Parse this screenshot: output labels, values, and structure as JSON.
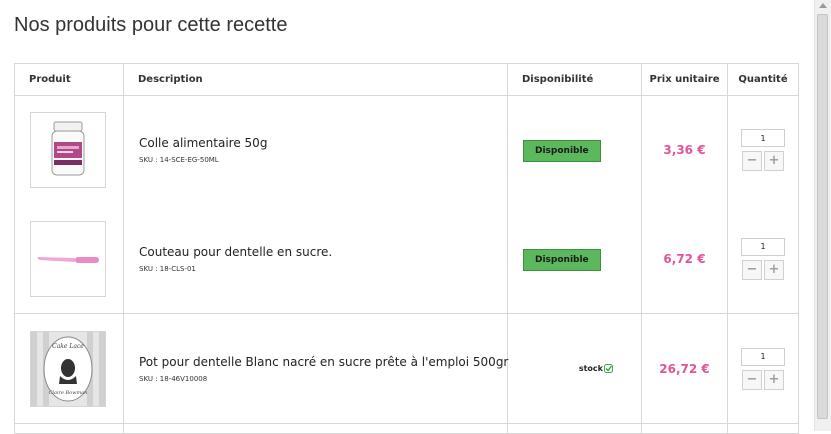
{
  "page": {
    "title": "Nos produits pour cette recette"
  },
  "table": {
    "headers": {
      "product": "Produit",
      "description": "Description",
      "availability": "Disponibilité",
      "unit_price": "Prix unitaire",
      "quantity": "Quantité"
    },
    "rows": [
      {
        "name": "Colle alimentaire 50g",
        "sku": "SKU : 14-SCE-EG-50ML",
        "availability": "Disponible",
        "price": "3,36 €",
        "quantity": "1",
        "image_icon": "glue-jar-icon"
      },
      {
        "name": "Couteau pour dentelle en sucre.",
        "sku": "SKU : 18-CLS-01",
        "availability": "Disponible",
        "price": "6,72 €",
        "quantity": "1",
        "image_icon": "pink-knife-icon"
      },
      {
        "name": "Pot pour dentelle Blanc nacré en sucre prête à l'emploi 500gr",
        "sku": "SKU : 18-46V10008",
        "availability": "stock",
        "price": "26,72 €",
        "quantity": "1",
        "image_icon": "cake-lace-label-icon",
        "image_text_top": "Cake Lace",
        "image_text_bottom": "Claire Bowman"
      }
    ],
    "qty_controls": {
      "minus": "−",
      "plus": "+"
    }
  },
  "colors": {
    "price": "#e0559a",
    "available_badge": "#5cb85c",
    "border": "#d8d8d8"
  }
}
